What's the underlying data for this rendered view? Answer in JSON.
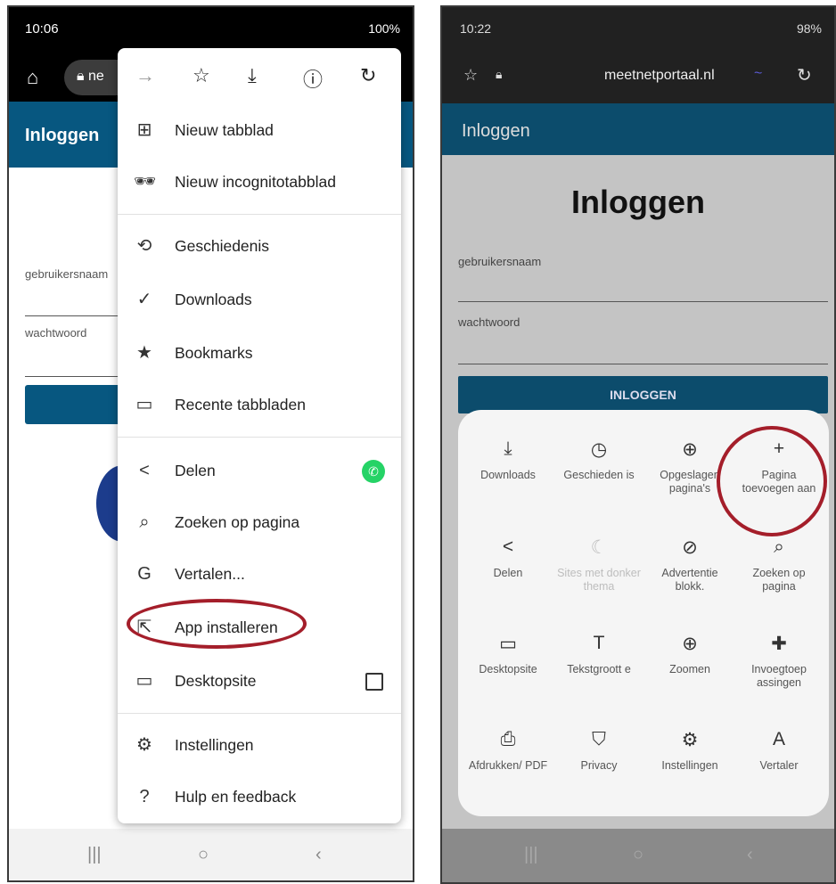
{
  "left_phone": {
    "status_time": "10:06",
    "status_right": "100%",
    "url_text": "ne",
    "page_header": "Inloggen",
    "username_label": "gebruikersnaam",
    "password_label": "wachtwoord",
    "menu_items": [
      {
        "icon": "new-tab-icon",
        "label": "Nieuw tabblad"
      },
      {
        "icon": "incognito-icon",
        "label": "Nieuw incognitotabblad"
      },
      {
        "icon": "history-icon",
        "label": "Geschiedenis"
      },
      {
        "icon": "downloads-icon",
        "label": "Downloads"
      },
      {
        "icon": "bookmark-star-icon",
        "label": "Bookmarks"
      },
      {
        "icon": "devices-icon",
        "label": "Recente tabbladen"
      },
      {
        "icon": "share-icon",
        "label": "Delen"
      },
      {
        "icon": "find-icon",
        "label": "Zoeken op pagina"
      },
      {
        "icon": "translate-icon",
        "label": "Vertalen..."
      },
      {
        "icon": "install-app-icon",
        "label": "App installeren"
      },
      {
        "icon": "desktop-icon",
        "label": "Desktopsite"
      },
      {
        "icon": "settings-gear-icon",
        "label": "Instellingen"
      },
      {
        "icon": "help-icon",
        "label": "Hulp en feedback"
      }
    ],
    "accent_color": "#075780",
    "highlight_color": "#a41e2a"
  },
  "right_phone": {
    "status_time": "10:22",
    "status_right": "98%",
    "url_text": "meetnetportaal.nl",
    "page_header": "Inloggen",
    "page_title": "Inloggen",
    "username_label": "gebruikersnaam",
    "password_label": "wachtwoord",
    "login_button": "INLOGGEN",
    "tiles": [
      {
        "icon": "download-icon",
        "label": "Downloads"
      },
      {
        "icon": "clock-icon",
        "label": "Geschieden is"
      },
      {
        "icon": "saved-pages-icon",
        "label": "Opgeslagen pagina's"
      },
      {
        "icon": "plus-icon",
        "label": "Pagina toevoegen aan"
      },
      {
        "icon": "share-icon",
        "label": "Delen"
      },
      {
        "icon": "moon-icon",
        "label": "Sites met donker thema"
      },
      {
        "icon": "ad-block-icon",
        "label": "Advertentie blokk."
      },
      {
        "icon": "find-icon",
        "label": "Zoeken op pagina"
      },
      {
        "icon": "desktop-icon",
        "label": "Desktopsite"
      },
      {
        "icon": "text-size-icon",
        "label": "Tekstgroott e"
      },
      {
        "icon": "zoom-icon",
        "label": "Zoomen"
      },
      {
        "icon": "addons-icon",
        "label": "Invoegtoep assingen"
      },
      {
        "icon": "print-icon",
        "label": "Afdrukken/ PDF"
      },
      {
        "icon": "privacy-icon",
        "label": "Privacy"
      },
      {
        "icon": "settings-gear-icon",
        "label": "Instellingen"
      },
      {
        "icon": "translate-icon",
        "label": "Vertaler"
      }
    ],
    "accent_color": "#0c4c6c"
  }
}
